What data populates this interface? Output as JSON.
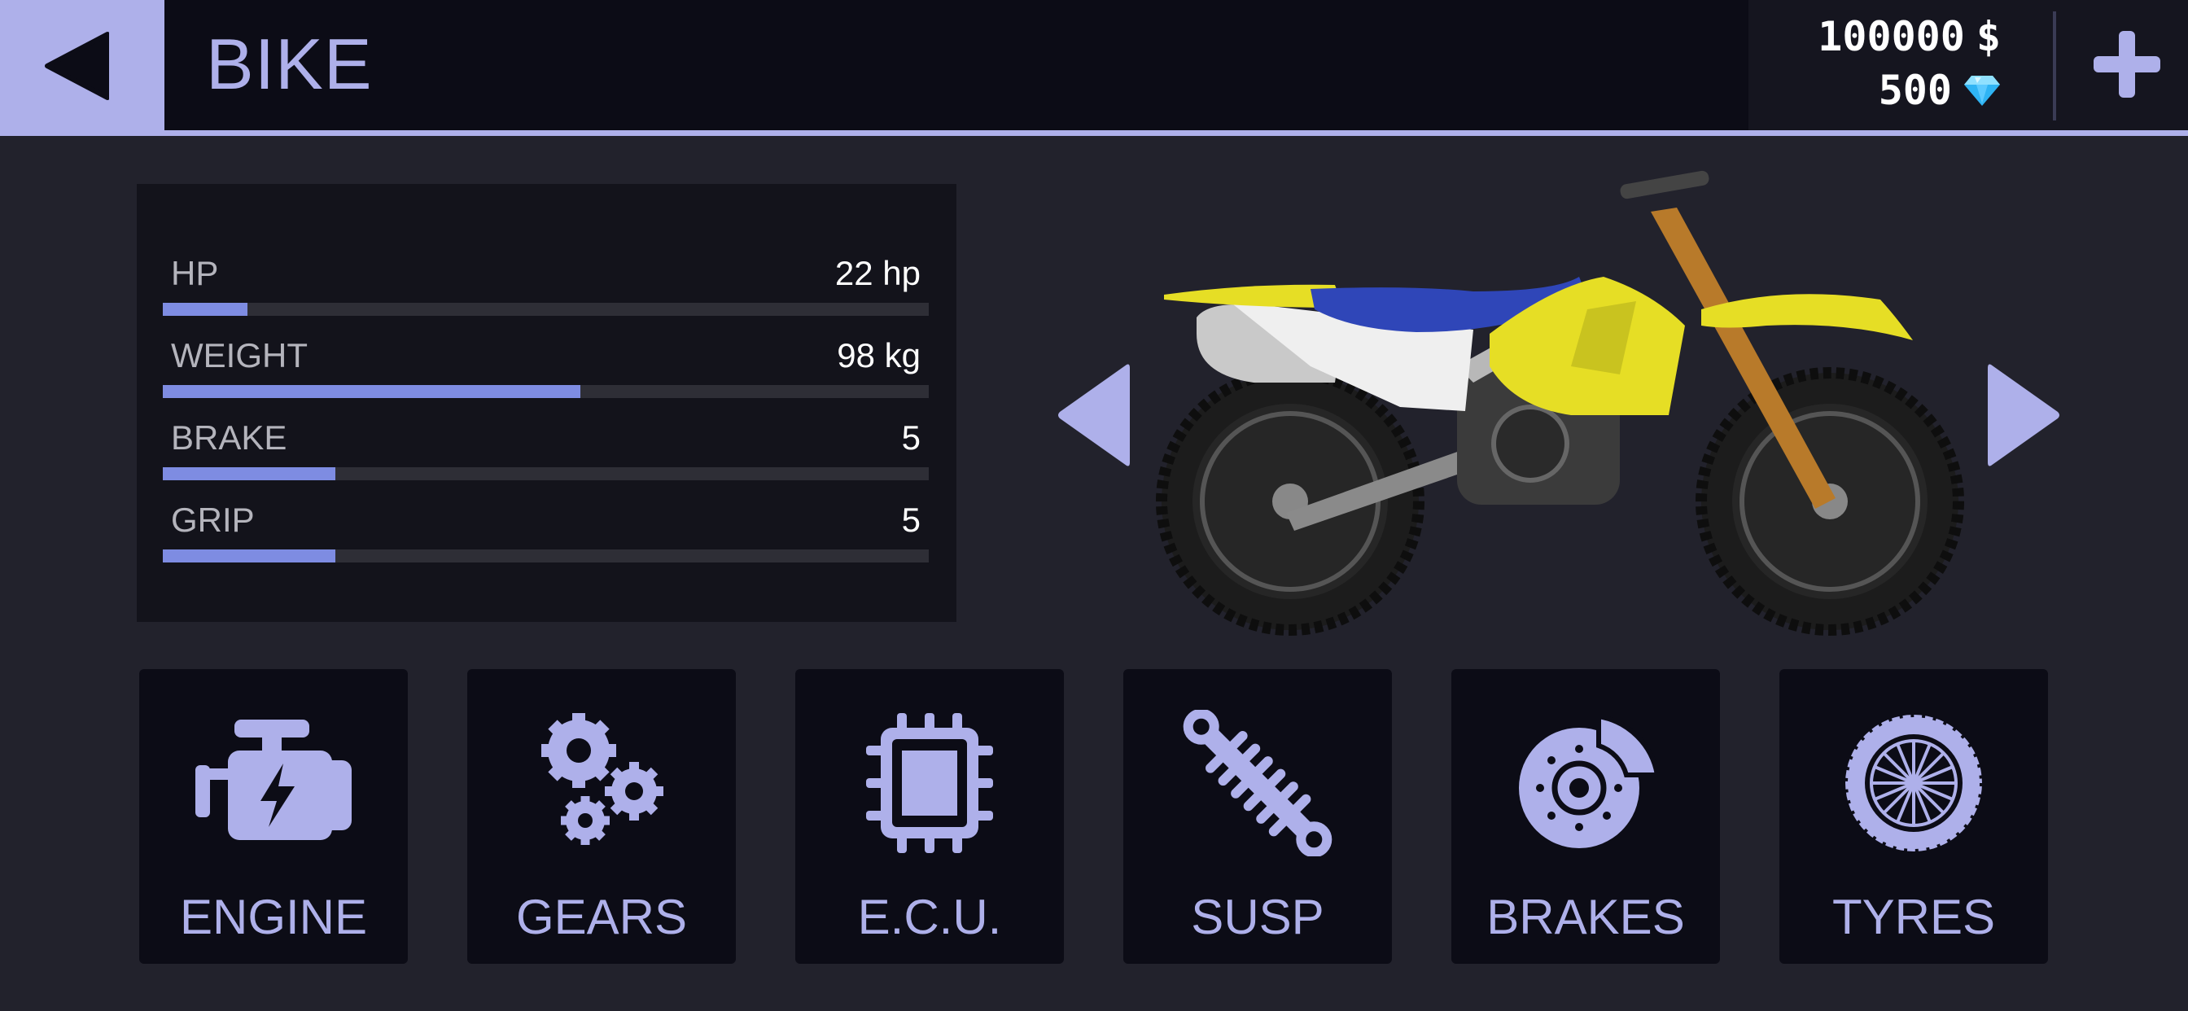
{
  "header": {
    "title": "BIKE",
    "back_icon": "back-arrow-icon",
    "add_icon": "plus-icon"
  },
  "wallet": {
    "cash": "100000",
    "cash_symbol": "$",
    "gems": "500",
    "gem_icon": "diamond-icon"
  },
  "stats": [
    {
      "label": "HP",
      "value": "22 hp",
      "fill": 0.11
    },
    {
      "label": "WEIGHT",
      "value": "98 kg",
      "fill": 0.545
    },
    {
      "label": "BRAKE",
      "value": "5",
      "fill": 0.225
    },
    {
      "label": "GRIP",
      "value": "5",
      "fill": 0.225
    }
  ],
  "bike_viewer": {
    "prev_icon": "chevron-left-icon",
    "next_icon": "chevron-right-icon",
    "bike_colors": {
      "body": "#e6de25",
      "seat": "#2f46b8",
      "side_panel": "#efefef"
    }
  },
  "upgrades": [
    {
      "label": "ENGINE",
      "icon": "engine-icon"
    },
    {
      "label": "GEARS",
      "icon": "gears-icon"
    },
    {
      "label": "E.C.U.",
      "icon": "chip-icon"
    },
    {
      "label": "SUSP",
      "icon": "suspension-icon"
    },
    {
      "label": "BRAKES",
      "icon": "brake-disc-icon"
    },
    {
      "label": "TYRES",
      "icon": "tyre-icon"
    }
  ],
  "colors": {
    "accent": "#aeb0ea",
    "bar_fill": "#7e8ce2",
    "background": "#22222c",
    "panel": "#13131b",
    "tile": "#0c0c16"
  }
}
